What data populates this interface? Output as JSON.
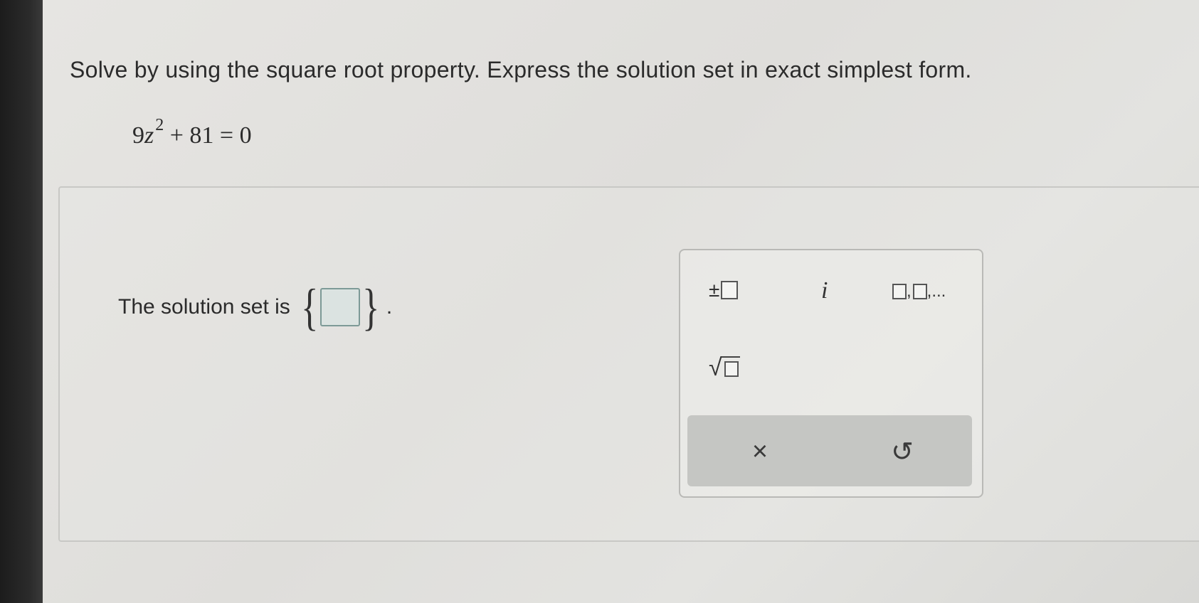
{
  "question": {
    "instruction": "Solve by using the square root property. Express the solution set in exact simplest form.",
    "equation": {
      "coefficient": "9",
      "variable": "z",
      "exponent": "2",
      "rest": "+ 81 = 0"
    }
  },
  "answer": {
    "label": "The solution set is",
    "open_brace": "{",
    "close_brace": "}",
    "period": ".",
    "value": ""
  },
  "palette": {
    "plus_minus_symbol": "±",
    "imaginary_symbol": "i",
    "list_symbol": ",",
    "list_ellipsis": ",...",
    "sqrt_symbol": "√",
    "clear_symbol": "×",
    "undo_symbol": "↺",
    "icons": [
      "plus-minus-icon",
      "imaginary-unit-icon",
      "list-icon",
      "square-root-icon",
      "clear-icon",
      "undo-icon"
    ]
  },
  "colors": {
    "answer_box_border": "#7d9a97",
    "answer_box_fill": "#dbe3e1",
    "action_bar": "#c5c6c3"
  }
}
